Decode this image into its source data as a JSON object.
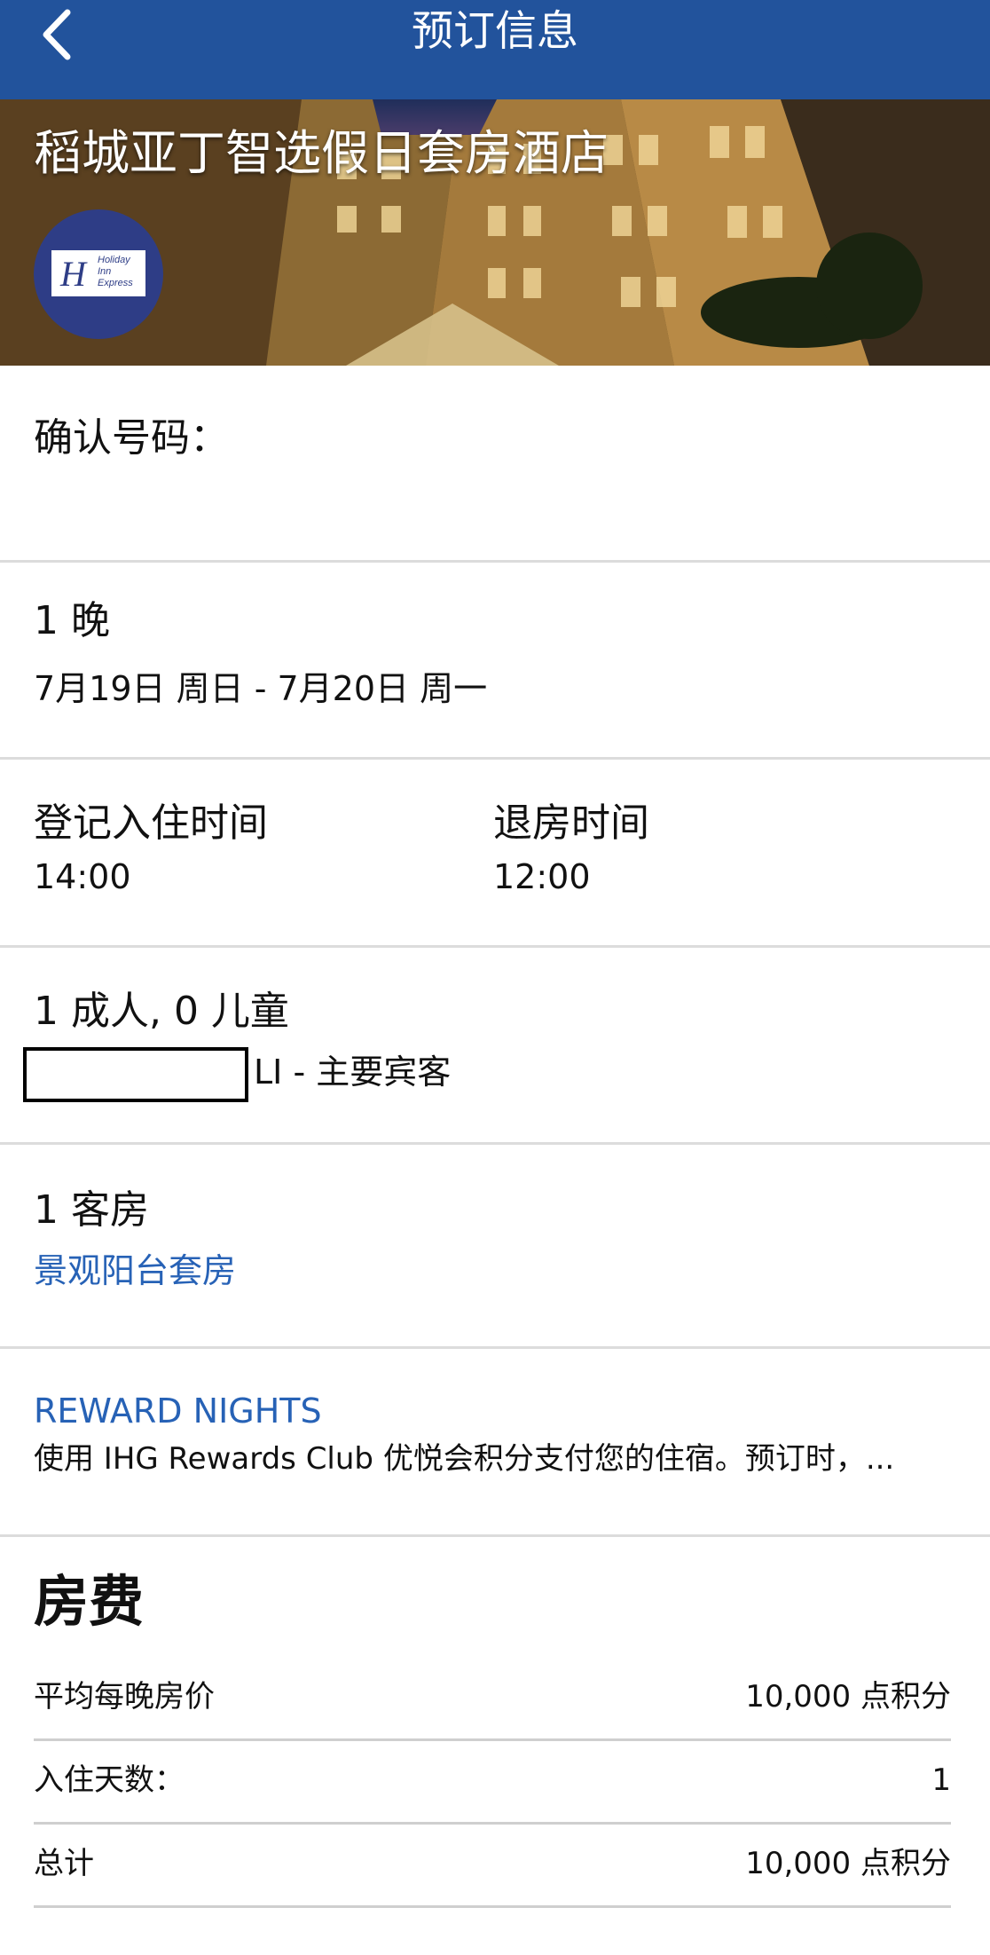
{
  "header": {
    "title": "预订信息"
  },
  "hotel": {
    "name": "稻城亚丁智选假日套房酒店",
    "logo_text": "Holiday Inn Express"
  },
  "confirmation": {
    "label": "确认号码："
  },
  "stay": {
    "nights": "1 晚",
    "dates": "7月19日 周日 - 7月20日 周一"
  },
  "times": {
    "checkin_label": "登记入住时间",
    "checkin_value": "14:00",
    "checkout_label": "退房时间",
    "checkout_value": "12:00"
  },
  "guests": {
    "count": "1 成人, 0 儿童",
    "primary_guest": "LI  - 主要宾客"
  },
  "room": {
    "count": "1 客房",
    "type": "景观阳台套房"
  },
  "reward": {
    "title": "REWARD NIGHTS",
    "description": "使用 IHG Rewards Club 优悦会积分支付您的住宿。预订时，..."
  },
  "fees": {
    "title": "房费",
    "rows": [
      {
        "label": "平均每晚房价",
        "value": "10,000 点积分"
      },
      {
        "label": "入住天数：",
        "value": "1"
      },
      {
        "label": "总计",
        "value": "10,000 点积分"
      }
    ]
  },
  "colors": {
    "header_bg": "#22539c",
    "link": "#2762b6",
    "logo_bg": "#2e3d86"
  },
  "icons": {
    "back": "chevron-left-icon",
    "logo": "holiday-inn-express-logo"
  }
}
